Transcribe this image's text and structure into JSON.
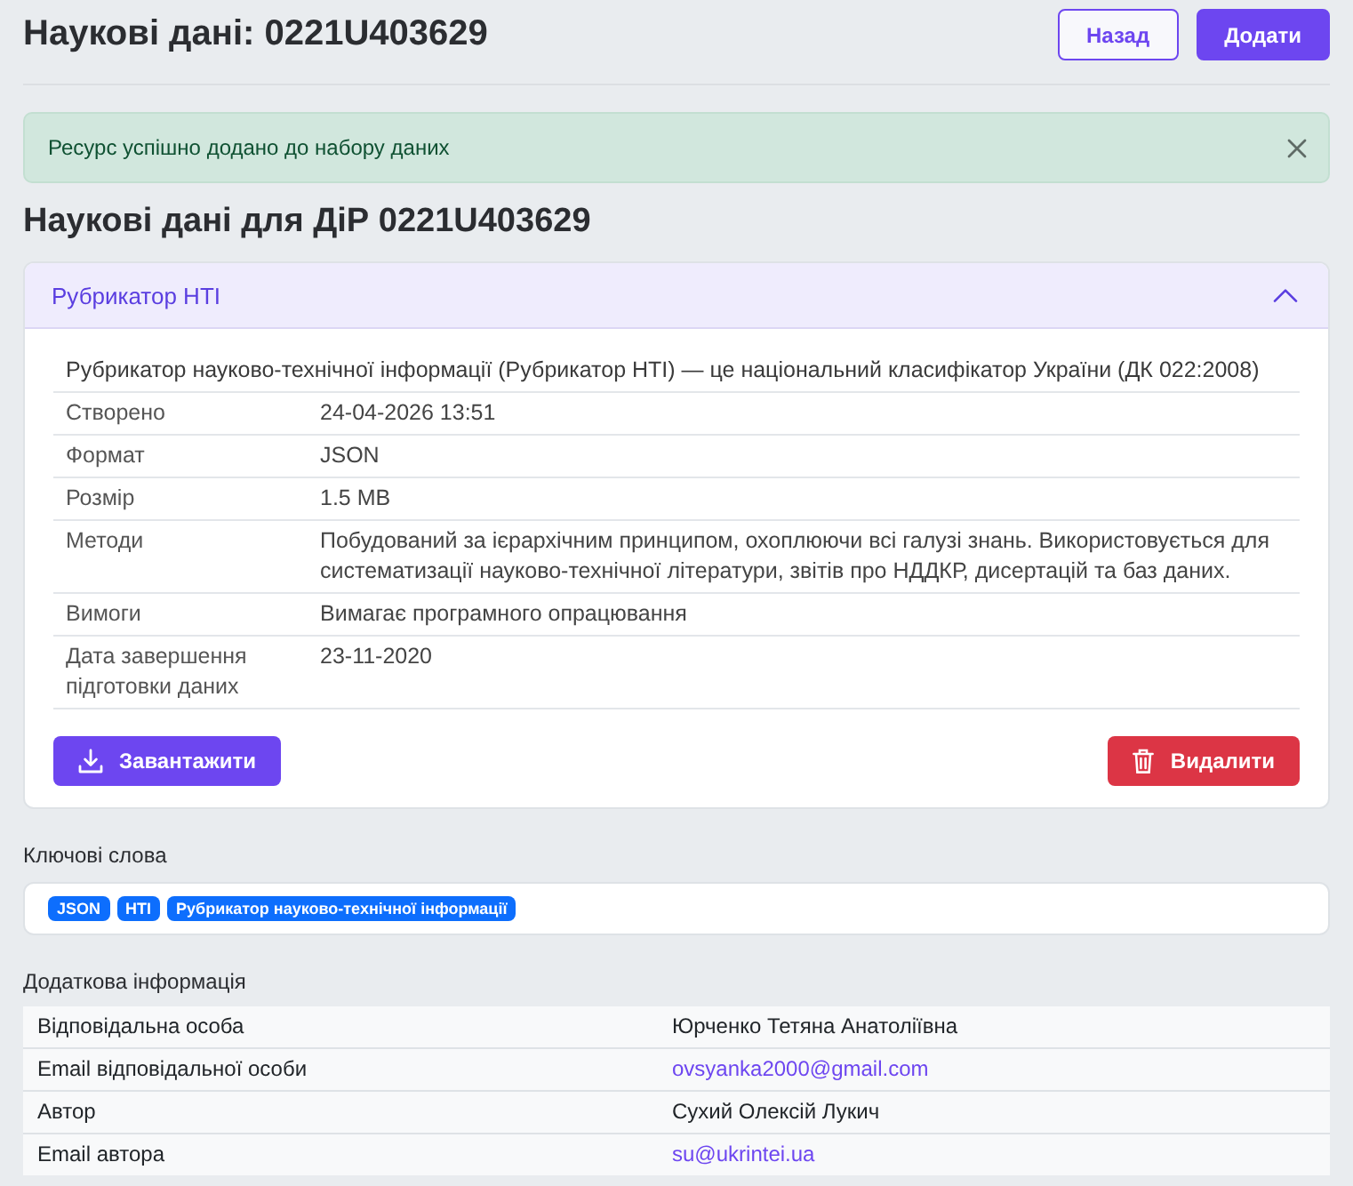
{
  "header": {
    "title": "Наукові дані: 0221U403629",
    "buttons": [
      {
        "label": "Назад",
        "kind": "outline"
      },
      {
        "label": "Додати",
        "kind": "primary"
      }
    ]
  },
  "alert": {
    "message": "Ресурс успішно додано до набору даних"
  },
  "section_title": "Наукові дані для ДіР 0221U403629",
  "resource": {
    "title": "Рубрикатор НТІ",
    "expanded": true,
    "description": "Рубрикатор науково-технічної інформації (Рубрикатор НТІ) — це національний класифікатор України (ДК 022:2008)",
    "fields": [
      {
        "label": "Створено",
        "value": "24-04-2026 13:51"
      },
      {
        "label": "Формат",
        "value": "JSON"
      },
      {
        "label": "Розмір",
        "value": "1.5 MB"
      },
      {
        "label": "Методи",
        "value": "Побудований за ієрархічним принципом, охоплюючи всі галузі знань. Використовується для систематизації науково-технічної літератури, звітів про НДДКР, дисертацій та баз даних."
      },
      {
        "label": "Вимоги",
        "value": "Вимагає програмного опрацювання"
      },
      {
        "label": "Дата завершення підготовки даних",
        "value": "23-11-2020"
      }
    ],
    "actions": [
      {
        "label": "Завантажити",
        "kind": "download"
      },
      {
        "label": "Видалити",
        "kind": "delete"
      }
    ]
  },
  "keywords": {
    "label": "Ключові слова",
    "tags": [
      "JSON",
      "НТІ",
      "Рубрикатор науково-технічної інформації"
    ]
  },
  "additional_info": {
    "label": "Додаткова інформація",
    "rows": [
      {
        "label": "Відповідальна особа",
        "value": "Юрченко Тетяна Анатоліївна",
        "kind": "text"
      },
      {
        "label": "Email відповідальної особи",
        "value": "ovsyanka2000@gmail.com",
        "kind": "link"
      },
      {
        "label": "Автор",
        "value": "Сухий Олексій Лукич",
        "kind": "text"
      },
      {
        "label": "Email автора",
        "value": "su@ukrintei.ua",
        "kind": "link"
      }
    ]
  }
}
